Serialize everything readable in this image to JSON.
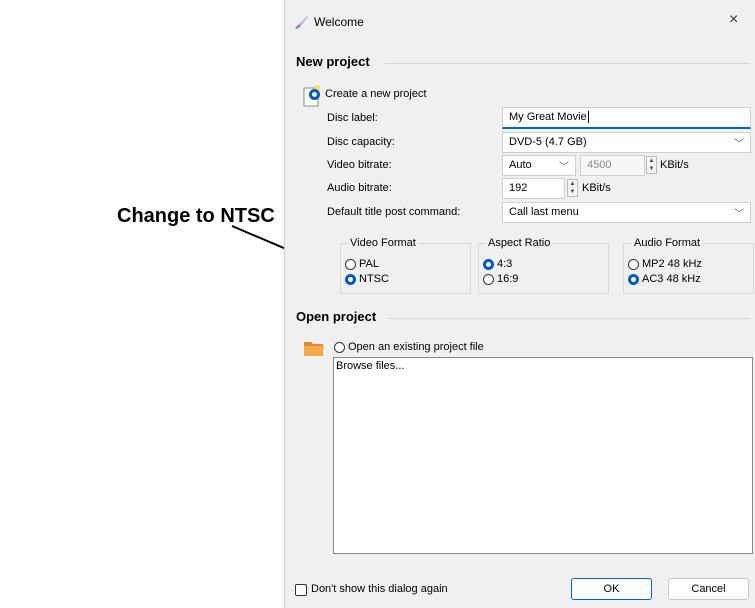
{
  "annotation": {
    "text": "Change to NTSC"
  },
  "window": {
    "title": "Welcome",
    "close_glyph": "×",
    "icon": "brush-icon"
  },
  "new_project": {
    "section_title": "New project",
    "create_label": "Create a new project",
    "disc_label": {
      "label": "Disc label:",
      "value": "My Great Movie"
    },
    "disc_capacity": {
      "label": "Disc capacity:",
      "value": "DVD-5 (4.7 GB)"
    },
    "video_bitrate": {
      "label": "Video bitrate:",
      "mode": "Auto",
      "value": "4500",
      "unit": "KBit/s"
    },
    "audio_bitrate": {
      "label": "Audio bitrate:",
      "value": "192",
      "unit": "KBit/s"
    },
    "post_command": {
      "label": "Default title post command:",
      "value": "Call last menu"
    },
    "video_format": {
      "title": "Video Format",
      "options": [
        "PAL",
        "NTSC"
      ],
      "selected": "NTSC"
    },
    "aspect_ratio": {
      "title": "Aspect Ratio",
      "options": [
        "4:3",
        "16:9"
      ],
      "selected": "4:3"
    },
    "audio_format": {
      "title": "Audio Format",
      "options": [
        "MP2 48 kHz",
        "AC3 48 kHz"
      ],
      "selected": "AC3 48 kHz"
    }
  },
  "open_project": {
    "section_title": "Open project",
    "open_label": "Open an existing project file",
    "browse_item": "Browse files..."
  },
  "footer": {
    "dont_show": "Don't show this dialog again",
    "ok": "OK",
    "cancel": "Cancel"
  },
  "colors": {
    "accent": "#0067c0",
    "dialog_bg": "#f0f0f0"
  }
}
